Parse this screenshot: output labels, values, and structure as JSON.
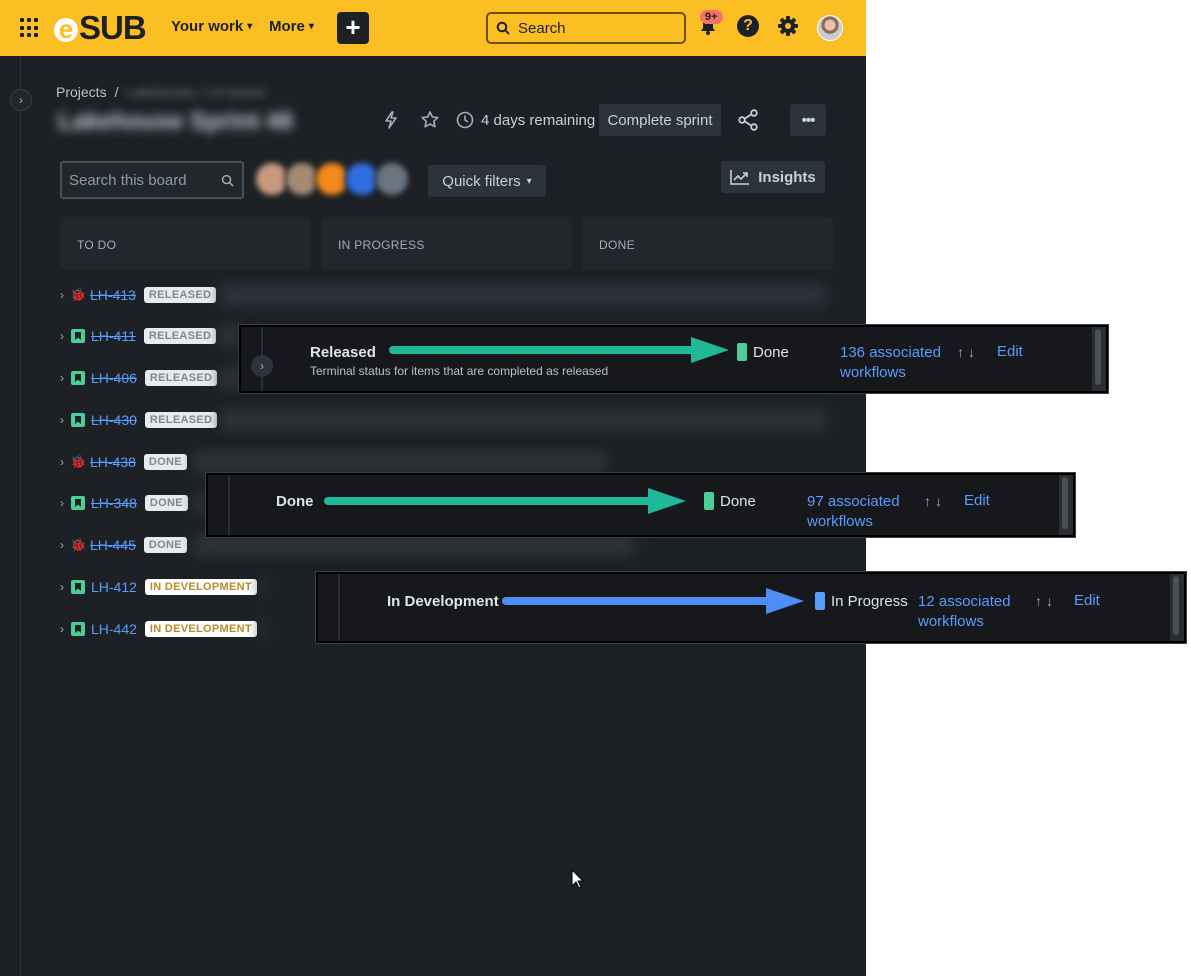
{
  "topbar": {
    "logo_e": "e",
    "logo_text": "SUB",
    "your_work": "Your work",
    "more": "More",
    "create": "+",
    "search_label": "Search",
    "notifications_badge": "9+",
    "help": "?"
  },
  "header": {
    "breadcrumb_root": "Projects",
    "breadcrumb_sep": "/",
    "breadcrumb_project": "Lakehouse / LH board",
    "board_title": "Lakehouse Sprint 48",
    "days_remaining": "4 days remaining",
    "complete_sprint": "Complete sprint",
    "more_actions": "•••"
  },
  "filters": {
    "search_placeholder": "Search this board",
    "quick_filters": "Quick filters",
    "insights": "Insights"
  },
  "columns": [
    "TO DO",
    "IN PROGRESS",
    "DONE"
  ],
  "issues": [
    {
      "key": "LH-413",
      "type": "bug",
      "status": "RELEASED",
      "strike": true
    },
    {
      "key": "LH-411",
      "type": "story",
      "status": "RELEASED",
      "strike": true
    },
    {
      "key": "LH-406",
      "type": "story",
      "status": "RELEASED",
      "strike": true
    },
    {
      "key": "LH-430",
      "type": "story",
      "status": "RELEASED",
      "strike": true
    },
    {
      "key": "LH-438",
      "type": "bug",
      "status": "DONE",
      "strike": true
    },
    {
      "key": "LH-348",
      "type": "story",
      "status": "DONE",
      "strike": true
    },
    {
      "key": "LH-445",
      "type": "bug",
      "status": "DONE",
      "strike": true
    },
    {
      "key": "LH-412",
      "type": "story",
      "status": "IN DEVELOPMENT",
      "strike": false
    },
    {
      "key": "LH-442",
      "type": "story",
      "status": "IN DEVELOPMENT",
      "strike": false
    }
  ],
  "callouts": {
    "released": {
      "name": "Released",
      "description": "Terminal status for items that are completed as released",
      "category": "Done",
      "category_color": "#4bce97",
      "workflows_line1": "136 associated",
      "workflows_line2": "workflows",
      "edit": "Edit"
    },
    "done": {
      "name": "Done",
      "category": "Done",
      "category_color": "#4bce97",
      "workflows_line1": "97 associated",
      "workflows_line2": "workflows",
      "edit": "Edit"
    },
    "in_development": {
      "name": "In Development",
      "category": "In Progress",
      "category_color": "#579dff",
      "workflows_line1": "12 associated",
      "workflows_line2": "workflows",
      "edit": "Edit"
    }
  },
  "colors": {
    "topbar": "#fbbf24",
    "background": "#1d2125",
    "link": "#579dff",
    "arrow_green": "#1fb99a",
    "arrow_blue": "#4c8df6"
  }
}
